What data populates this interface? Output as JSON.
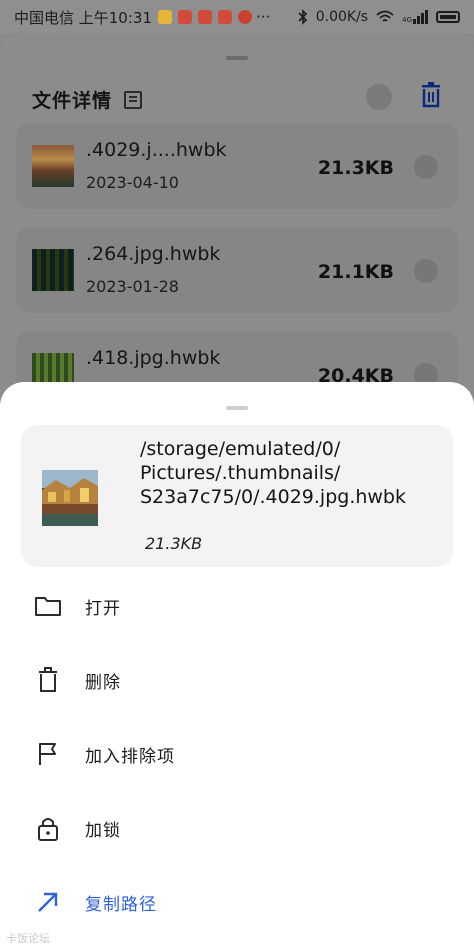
{
  "status_bar": {
    "carrier_time": "中国电信 上午10:31",
    "more": "···",
    "net_speed": "0.00K/s",
    "network": "4G"
  },
  "background": {
    "title": "文件详情",
    "items": [
      {
        "name": ".4029.j....hwbk",
        "date": "2023-04-10",
        "size": "21.3KB"
      },
      {
        "name": ".264.jpg.hwbk",
        "date": "2023-01-28",
        "size": "21.1KB"
      },
      {
        "name": ".418.jpg.hwbk",
        "date": "",
        "size": "20.4KB"
      }
    ]
  },
  "sheet": {
    "file_path_lines": [
      "/storage/emulated/0/",
      "Pictures/.thumbnails/",
      "S23a7c75/0/.4029.jpg.hwbk"
    ],
    "file_size": "21.3KB",
    "actions": [
      {
        "label": "打开",
        "icon": "folder-icon"
      },
      {
        "label": "删除",
        "icon": "trash-icon"
      },
      {
        "label": "加入排除项",
        "icon": "flag-icon"
      },
      {
        "label": "加锁",
        "icon": "lock-icon"
      },
      {
        "label": "复制路径",
        "icon": "arrow-up-right-icon"
      }
    ]
  },
  "watermark": "卡饭论坛",
  "colors": {
    "accent": "#2f62d6",
    "dark_trash": "#0b2a7a"
  }
}
